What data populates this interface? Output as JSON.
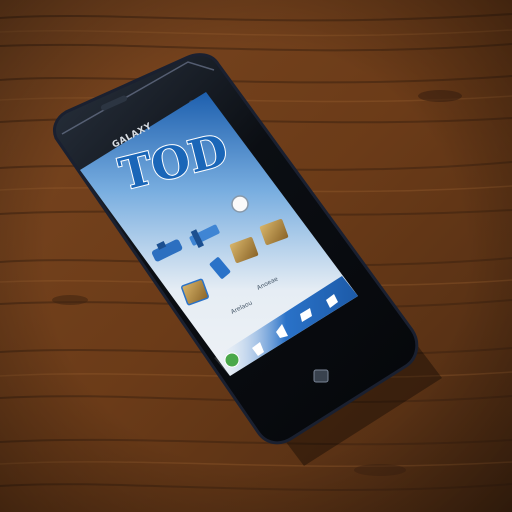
{
  "scene": {
    "description_free": true,
    "background": {
      "wood_base": "#6b3f1c",
      "wood_light": "#8a5428",
      "wood_dark": "#3e2210"
    }
  },
  "phone": {
    "brand_label": "GALAXY",
    "logo_text": "TOD",
    "screen_colors": {
      "sky_top": "#1d5fae",
      "sky_mid": "#79aee0",
      "sky_bottom": "#e6edf4",
      "dock": "#2a72c8"
    },
    "home_screen": {
      "labels": [
        "Arelaou",
        "Anoeae"
      ]
    },
    "icons": [
      {
        "name": "toggle-icon"
      },
      {
        "name": "controller-icon"
      },
      {
        "name": "connector-icon"
      },
      {
        "name": "folder-icon"
      },
      {
        "name": "gold-box-icon"
      },
      {
        "name": "keyboard-icon"
      },
      {
        "name": "square-icon"
      },
      {
        "name": "globe-icon"
      },
      {
        "name": "bird-icon"
      },
      {
        "name": "tools-icon"
      },
      {
        "name": "plane-icon"
      },
      {
        "name": "puzzle-icon"
      }
    ]
  }
}
